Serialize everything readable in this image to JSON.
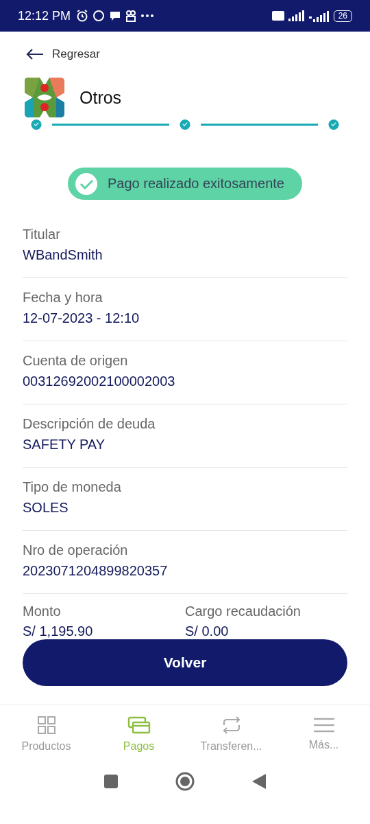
{
  "status_bar": {
    "time": "12:12 PM",
    "battery": "26"
  },
  "back": {
    "label": "Regresar"
  },
  "header": {
    "title": "Otros"
  },
  "steps": [
    {
      "done": true
    },
    {
      "done": true
    },
    {
      "done": true
    }
  ],
  "success": {
    "message": "Pago realizado exitosamente"
  },
  "fields": [
    {
      "label": "Titular",
      "value": "WBandSmith"
    },
    {
      "label": "Fecha y hora",
      "value": "12-07-2023 - 12:10"
    },
    {
      "label": "Cuenta de origen",
      "value": "00312692002100002003"
    },
    {
      "label": "Descripción de deuda",
      "value": "SAFETY PAY"
    },
    {
      "label": "Tipo de moneda",
      "value": "SOLES"
    },
    {
      "label": "Nro de operación",
      "value": "2023071204899820357"
    }
  ],
  "amounts": [
    {
      "label": "Monto",
      "value": "S/ 1,195.90"
    },
    {
      "label": "Cargo recaudación",
      "value": "S/ 0.00"
    }
  ],
  "primary_button": {
    "label": "Volver"
  },
  "bottom_nav": [
    {
      "label": "Productos",
      "kind": "grid",
      "selected": false
    },
    {
      "label": "Pagos",
      "kind": "cards",
      "selected": true
    },
    {
      "label": "Transferen...",
      "kind": "swap",
      "selected": false
    },
    {
      "label": "Más...",
      "kind": "menu",
      "selected": false
    }
  ]
}
